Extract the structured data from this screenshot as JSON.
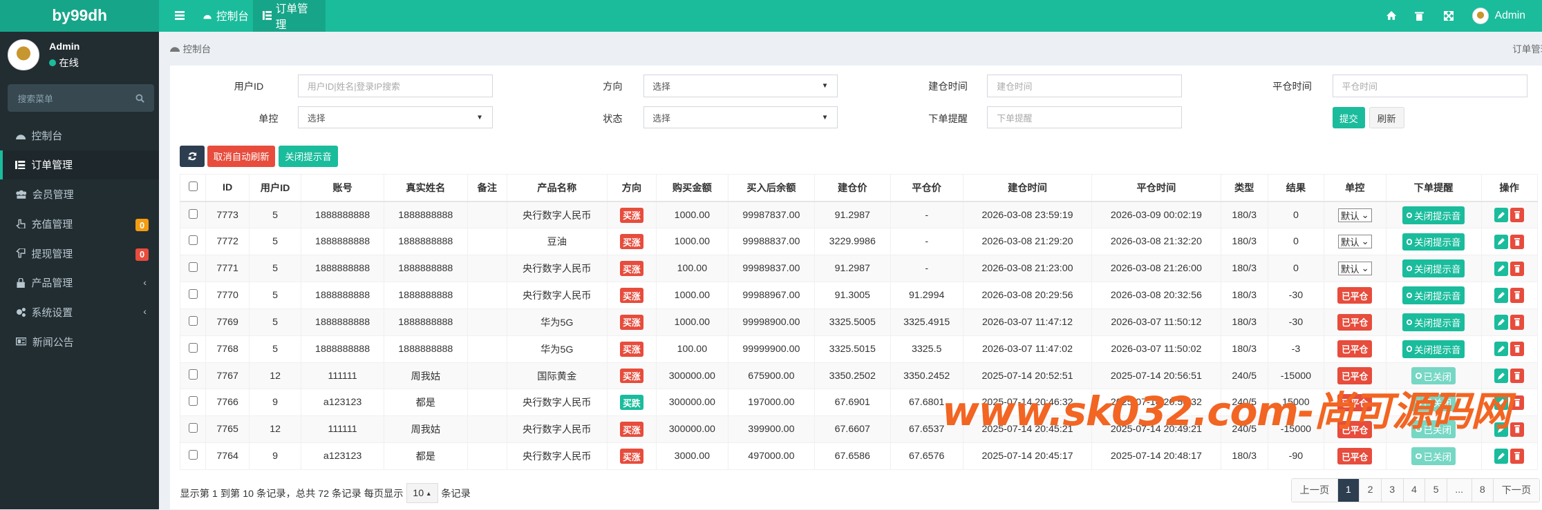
{
  "app": {
    "logo": "by99dh",
    "user": "Admin"
  },
  "topbar": {
    "tabs": [
      {
        "label": "控制台"
      },
      {
        "label": "订单管理"
      }
    ]
  },
  "sidebar": {
    "user": "Admin",
    "status": "在线",
    "search_placeholder": "搜索菜单",
    "items": [
      {
        "label": "控制台"
      },
      {
        "label": "订单管理"
      },
      {
        "label": "会员管理"
      },
      {
        "label": "充值管理",
        "badge": "0"
      },
      {
        "label": "提现管理",
        "badge": "0"
      },
      {
        "label": "产品管理"
      },
      {
        "label": "系统设置"
      },
      {
        "label": "新闻公告"
      }
    ]
  },
  "breadcrumb": {
    "left": "控制台",
    "right": "订单管理"
  },
  "filters": {
    "user_label": "用户ID",
    "user_placeholder": "用户ID|姓名|登录IP搜索",
    "dir_label": "方向",
    "dir_value": "选择",
    "open_label": "建仓时间",
    "open_placeholder": "建仓时间",
    "close_label": "平仓时间",
    "close_placeholder": "平仓时间",
    "ctrl_label": "单控",
    "ctrl_value": "选择",
    "state_label": "状态",
    "state_value": "选择",
    "remind_label": "下单提醒",
    "remind_placeholder": "下单提醒",
    "submit": "提交",
    "reset": "刷新"
  },
  "actions": {
    "cancel_refresh": "取消自动刷新",
    "mute": "关闭提示音"
  },
  "colors": {
    "accent": "#1abc9c",
    "danger": "#e74c3c",
    "dark": "#2c3e50",
    "sidebar": "#222d32"
  },
  "table": {
    "headers": [
      "ID",
      "用户ID",
      "账号",
      "真实姓名",
      "备注",
      "产品名称",
      "方向",
      "购买金额",
      "买入后余额",
      "建仓价",
      "平仓价",
      "建仓时间",
      "平仓时间",
      "类型",
      "结果",
      "单控",
      "下单提醒",
      "操作"
    ],
    "rows": [
      {
        "id": "7773",
        "uid": "5",
        "acct": "1888888888",
        "name": "1888888888",
        "note": "",
        "product": "央行数字人民币",
        "dir": "买涨",
        "amount": "1000.00",
        "balance": "99987837.00",
        "open": "91.2987",
        "close": "-",
        "otime": "2026-03-08 23:59:19",
        "ctime": "2026-03-09 00:02:19",
        "type": "180/3",
        "result": "0",
        "ctrl": "默认",
        "status": "",
        "remind": "关闭提示音",
        "remind_on": true
      },
      {
        "id": "7772",
        "uid": "5",
        "acct": "1888888888",
        "name": "1888888888",
        "note": "",
        "product": "豆油",
        "dir": "买涨",
        "amount": "1000.00",
        "balance": "99988837.00",
        "open": "3229.9986",
        "close": "-",
        "otime": "2026-03-08 21:29:20",
        "ctime": "2026-03-08 21:32:20",
        "type": "180/3",
        "result": "0",
        "ctrl": "默认",
        "status": "",
        "remind": "关闭提示音",
        "remind_on": true
      },
      {
        "id": "7771",
        "uid": "5",
        "acct": "1888888888",
        "name": "1888888888",
        "note": "",
        "product": "央行数字人民币",
        "dir": "买涨",
        "amount": "100.00",
        "balance": "99989837.00",
        "open": "91.2987",
        "close": "-",
        "otime": "2026-03-08 21:23:00",
        "ctime": "2026-03-08 21:26:00",
        "type": "180/3",
        "result": "0",
        "ctrl": "默认",
        "status": "",
        "remind": "关闭提示音",
        "remind_on": true
      },
      {
        "id": "7770",
        "uid": "5",
        "acct": "1888888888",
        "name": "1888888888",
        "note": "",
        "product": "央行数字人民币",
        "dir": "买涨",
        "amount": "1000.00",
        "balance": "99988967.00",
        "open": "91.3005",
        "close": "91.2994",
        "otime": "2026-03-08 20:29:56",
        "ctime": "2026-03-08 20:32:56",
        "type": "180/3",
        "result": "-30",
        "ctrl": "",
        "status": "已平仓",
        "remind": "关闭提示音",
        "remind_on": true
      },
      {
        "id": "7769",
        "uid": "5",
        "acct": "1888888888",
        "name": "1888888888",
        "note": "",
        "product": "华为5G",
        "dir": "买涨",
        "amount": "1000.00",
        "balance": "99998900.00",
        "open": "3325.5005",
        "close": "3325.4915",
        "otime": "2026-03-07 11:47:12",
        "ctime": "2026-03-07 11:50:12",
        "type": "180/3",
        "result": "-30",
        "ctrl": "",
        "status": "已平仓",
        "remind": "关闭提示音",
        "remind_on": true
      },
      {
        "id": "7768",
        "uid": "5",
        "acct": "1888888888",
        "name": "1888888888",
        "note": "",
        "product": "华为5G",
        "dir": "买涨",
        "amount": "100.00",
        "balance": "99999900.00",
        "open": "3325.5015",
        "close": "3325.5",
        "otime": "2026-03-07 11:47:02",
        "ctime": "2026-03-07 11:50:02",
        "type": "180/3",
        "result": "-3",
        "ctrl": "",
        "status": "已平仓",
        "remind": "关闭提示音",
        "remind_on": true
      },
      {
        "id": "7767",
        "uid": "12",
        "acct": "111111",
        "name": "周我姑",
        "note": "",
        "product": "国际黄金",
        "dir": "买涨",
        "amount": "300000.00",
        "balance": "675900.00",
        "open": "3350.2502",
        "close": "3350.2452",
        "otime": "2025-07-14 20:52:51",
        "ctime": "2025-07-14 20:56:51",
        "type": "240/5",
        "result": "-15000",
        "ctrl": "",
        "status": "已平仓",
        "remind": "已关闭",
        "remind_on": false
      },
      {
        "id": "7766",
        "uid": "9",
        "acct": "a123123",
        "name": "都是",
        "note": "",
        "product": "央行数字人民币",
        "dir": "买跌",
        "amount": "300000.00",
        "balance": "197000.00",
        "open": "67.6901",
        "close": "67.6801",
        "otime": "2025-07-14 20:46:32",
        "ctime": "2025-07-14 20:50:32",
        "type": "240/5",
        "result": "15000",
        "ctrl": "",
        "status": "已平仓",
        "remind": "已关闭",
        "remind_on": false
      },
      {
        "id": "7765",
        "uid": "12",
        "acct": "111111",
        "name": "周我姑",
        "note": "",
        "product": "央行数字人民币",
        "dir": "买涨",
        "amount": "300000.00",
        "balance": "399900.00",
        "open": "67.6607",
        "close": "67.6537",
        "otime": "2025-07-14 20:45:21",
        "ctime": "2025-07-14 20:49:21",
        "type": "240/5",
        "result": "-15000",
        "ctrl": "",
        "status": "已平仓",
        "remind": "已关闭",
        "remind_on": false
      },
      {
        "id": "7764",
        "uid": "9",
        "acct": "a123123",
        "name": "都是",
        "note": "",
        "product": "央行数字人民币",
        "dir": "买涨",
        "amount": "3000.00",
        "balance": "497000.00",
        "open": "67.6586",
        "close": "67.6576",
        "otime": "2025-07-14 20:45:17",
        "ctime": "2025-07-14 20:48:17",
        "type": "180/3",
        "result": "-90",
        "ctrl": "",
        "status": "已平仓",
        "remind": "已关闭",
        "remind_on": false
      }
    ]
  },
  "footer": {
    "summary": "显示第 1 到第 10 条记录，总共 72 条记录 每页显示",
    "page_size": "10",
    "suffix": "条记录"
  },
  "pagination": {
    "prev": "上一页",
    "pages": [
      "1",
      "2",
      "3",
      "4",
      "5",
      "...",
      "8"
    ],
    "current": "1",
    "next": "下一页"
  },
  "watermark": "www.sk032.com-尚可源码网"
}
